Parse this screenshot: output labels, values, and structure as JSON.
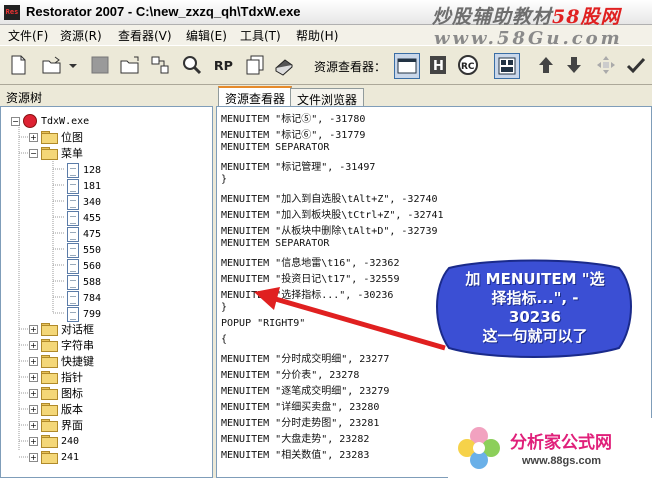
{
  "window": {
    "title": "Restorator 2007 - C:\\new_zxzq_qh\\TdxW.exe",
    "logo_text": "Res"
  },
  "watermark_top": {
    "line1_prefix": "炒股辅助教材",
    "line1_suffix": "58股网",
    "line2": "www.58Gu.com"
  },
  "menu": {
    "items": [
      "文件(F)",
      "资源(R)",
      "查看器(V)",
      "编辑(E)",
      "工具(T)",
      "帮助(H)"
    ]
  },
  "toolbar": {
    "viewer_label": "资源查看器："
  },
  "tree": {
    "header": "资源树",
    "root": "TdxW.exe",
    "top_folders": [
      "位图",
      "菜单"
    ],
    "menu_children": [
      "128",
      "181",
      "340",
      "455",
      "475",
      "550",
      "560",
      "588",
      "784",
      "799"
    ],
    "bottom_folders": [
      "对话框",
      "字符串",
      "快捷键",
      "指针",
      "图标",
      "版本",
      "界面",
      "240",
      "241"
    ]
  },
  "tabs": {
    "active": "资源查看器",
    "other": "文件浏览器"
  },
  "code": {
    "lines": [
      "  MENUITEM \"标记⑤\", -31780",
      "  MENUITEM \"标记⑥\", -31779",
      "  MENUITEM SEPARATOR",
      "  MENUITEM \"标记管理\", -31497",
      " }",
      " MENUITEM \"加入到自选股\\tAlt+Z\", -32740",
      " MENUITEM \"加入到板块股\\tCtrl+Z\", -32741",
      " MENUITEM \"从板块中删除\\tAlt+D\", -32739",
      " MENUITEM SEPARATOR",
      " MENUITEM \"信息地雷\\t16\", -32362",
      " MENUITEM \"投资日记\\t17\", -32559",
      " MENUITEM \"选择指标...\", -30236",
      "}",
      "POPUP \"RIGHT9\"",
      "{",
      " MENUITEM \"分时成交明细\", 23277",
      " MENUITEM \"分价表\", 23278",
      " MENUITEM \"逐笔成交明细\", 23279",
      " MENUITEM \"详细买卖盘\", 23280",
      " MENUITEM \"分时走势图\", 23281",
      " MENUITEM \"大盘走势\", 23282",
      " MENUITEM \"相关数值\", 23283"
    ]
  },
  "callout": {
    "lines": [
      "加 MENUITEM \"选",
      "择指标...\", -",
      "30236",
      "这一句就可以了"
    ]
  },
  "brand": {
    "name": "分析家公式网",
    "url": "www.88gs.com"
  },
  "colors": {
    "callout_fill": "#3b4fd4",
    "arrow": "#e02020",
    "watermark_red": "#e02020",
    "brand_pink": "#e0207a"
  }
}
